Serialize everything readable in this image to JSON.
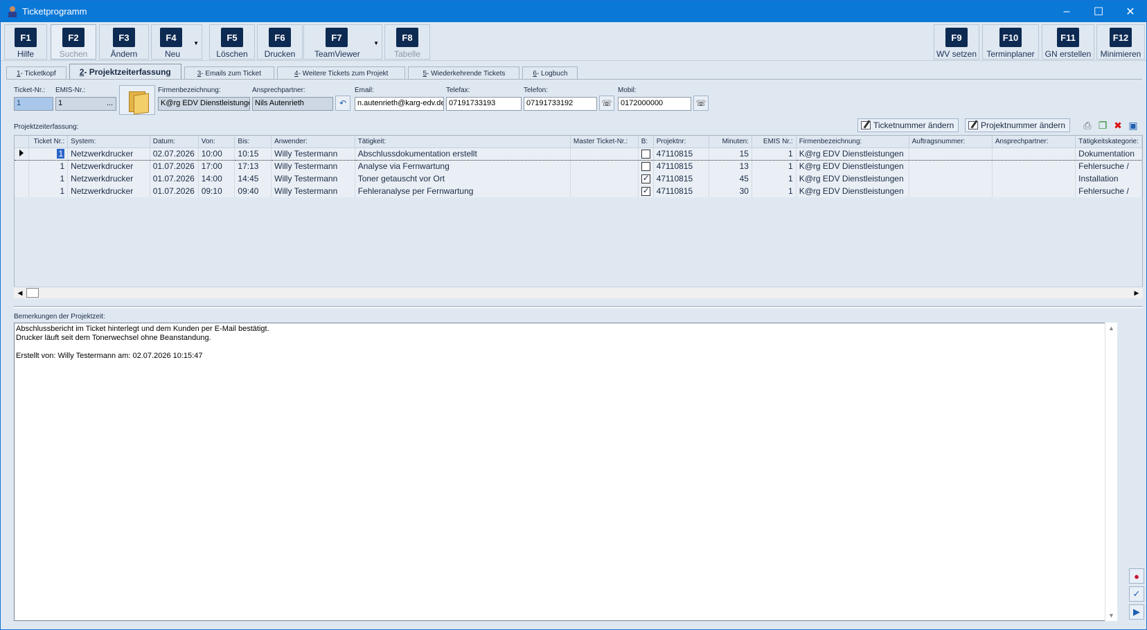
{
  "window": {
    "title": "Ticketprogramm"
  },
  "toolbar": {
    "buttons": [
      {
        "key": "F1",
        "label": "Hilfe"
      },
      {
        "key": "F2",
        "label": "Suchen"
      },
      {
        "key": "F3",
        "label": "Ändern"
      },
      {
        "key": "F4",
        "label": "Neu"
      },
      {
        "key": "F5",
        "label": "Löschen"
      },
      {
        "key": "F6",
        "label": "Drucken"
      },
      {
        "key": "F7",
        "label": "TeamViewer"
      },
      {
        "key": "F8",
        "label": "Tabelle"
      },
      {
        "key": "F9",
        "label": "WV setzen"
      },
      {
        "key": "F10",
        "label": "Terminplaner"
      },
      {
        "key": "F11",
        "label": "GN erstellen"
      },
      {
        "key": "F12",
        "label": "Minimieren"
      }
    ]
  },
  "tabs": [
    {
      "num": "1",
      "label": " - Ticketkopf"
    },
    {
      "num": "2",
      "label": " - Projektzeiterfassung"
    },
    {
      "num": "3",
      "label": " - Emails zum Ticket"
    },
    {
      "num": "4",
      "label": " - Weitere Tickets zum Projekt"
    },
    {
      "num": "5",
      "label": " - Wiederkehrende Tickets"
    },
    {
      "num": "6",
      "label": " - Logbuch"
    }
  ],
  "header": {
    "ticket_nr_label": "Ticket-Nr.:",
    "ticket_nr": "1",
    "emis_nr_label": "EMIS-Nr.:",
    "emis_nr": "1",
    "emis_btn": "...",
    "firma_label": "Firmenbezeichnung:",
    "firma": "K@rg EDV Dienstleistungen",
    "ansprech_label": "Ansprechpartner:",
    "ansprech": "Nils Autenrieth",
    "email_label": "Email:",
    "email": "n.autenrieth@karg-edv.de",
    "telefax_label": "Telefax:",
    "telefax": "07191733193",
    "telefon_label": "Telefon:",
    "telefon": "07191733192",
    "mobil_label": "Mobil:",
    "mobil": "0172000000"
  },
  "section": {
    "title": "Projektzeiterfassung:",
    "btn_ticketnr": "Ticketnummer ändern",
    "btn_projektnr": "Projektnummer ändern"
  },
  "grid": {
    "columns": [
      "Ticket Nr.:",
      "System:",
      "Datum:",
      "Von:",
      "Bis:",
      "Anwender:",
      "Tätigkeit:",
      "Master Ticket-Nr.:",
      "B:",
      "Projektnr:",
      "Minuten:",
      "EMIS Nr.:",
      "Firmenbezeichnung:",
      "Auftragsnummer:",
      "Ansprechpartner:",
      "Tätigkeitskategorie:"
    ],
    "rows": [
      {
        "ticket": "1",
        "system": "Netzwerkdrucker",
        "datum": "02.07.2026",
        "von": "10:00",
        "bis": "10:15",
        "anwender": "Willy Testermann",
        "taetigkeit": "Abschlussdokumentation erstellt",
        "master": "",
        "b": false,
        "projekt": "47110815",
        "minuten": "15",
        "emis": "1",
        "firma": "K@rg EDV Dienstleistungen",
        "auftrag": "",
        "ansprech": "",
        "kategorie": "Dokumentation"
      },
      {
        "ticket": "1",
        "system": "Netzwerkdrucker",
        "datum": "01.07.2026",
        "von": "17:00",
        "bis": "17:13",
        "anwender": "Willy Testermann",
        "taetigkeit": "Analyse via Fernwartung",
        "master": "",
        "b": false,
        "projekt": "47110815",
        "minuten": "13",
        "emis": "1",
        "firma": "K@rg EDV Dienstleistungen",
        "auftrag": "",
        "ansprech": "",
        "kategorie": "Fehlersuche /"
      },
      {
        "ticket": "1",
        "system": "Netzwerkdrucker",
        "datum": "01.07.2026",
        "von": "14:00",
        "bis": "14:45",
        "anwender": "Willy Testermann",
        "taetigkeit": "Toner getauscht vor Ort",
        "master": "",
        "b": true,
        "projekt": "47110815",
        "minuten": "45",
        "emis": "1",
        "firma": "K@rg EDV Dienstleistungen",
        "auftrag": "",
        "ansprech": "",
        "kategorie": "Installation"
      },
      {
        "ticket": "1",
        "system": "Netzwerkdrucker",
        "datum": "01.07.2026",
        "von": "09:10",
        "bis": "09:40",
        "anwender": "Willy Testermann",
        "taetigkeit": "Fehleranalyse per Fernwartung",
        "master": "",
        "b": true,
        "projekt": "47110815",
        "minuten": "30",
        "emis": "1",
        "firma": "K@rg EDV Dienstleistungen",
        "auftrag": "",
        "ansprech": "",
        "kategorie": "Fehlersuche /"
      }
    ]
  },
  "memo": {
    "label": "Bemerkungen der Projektzeit:",
    "text": "Abschlussbericht im Ticket hinterlegt und dem Kunden per E-Mail bestätigt.\nDrucker läuft seit dem Tonerwechsel ohne Beanstandung.\n\nErstellt von: Willy Testermann am: 02.07.2026 10:15:47"
  },
  "icons": {
    "app": "user-icon",
    "undo": "undo-icon",
    "phone": "phone-icon",
    "print": "printer-icon",
    "export": "export-icon",
    "delete": "delete-icon",
    "save": "save-icon",
    "lips": "lips-icon",
    "spell": "spellcheck-icon",
    "insert": "insert-icon"
  },
  "colors": {
    "titlebar": "#0a78d7",
    "key_bg": "#0d2a52",
    "window_bg": "#dfe8f1"
  }
}
